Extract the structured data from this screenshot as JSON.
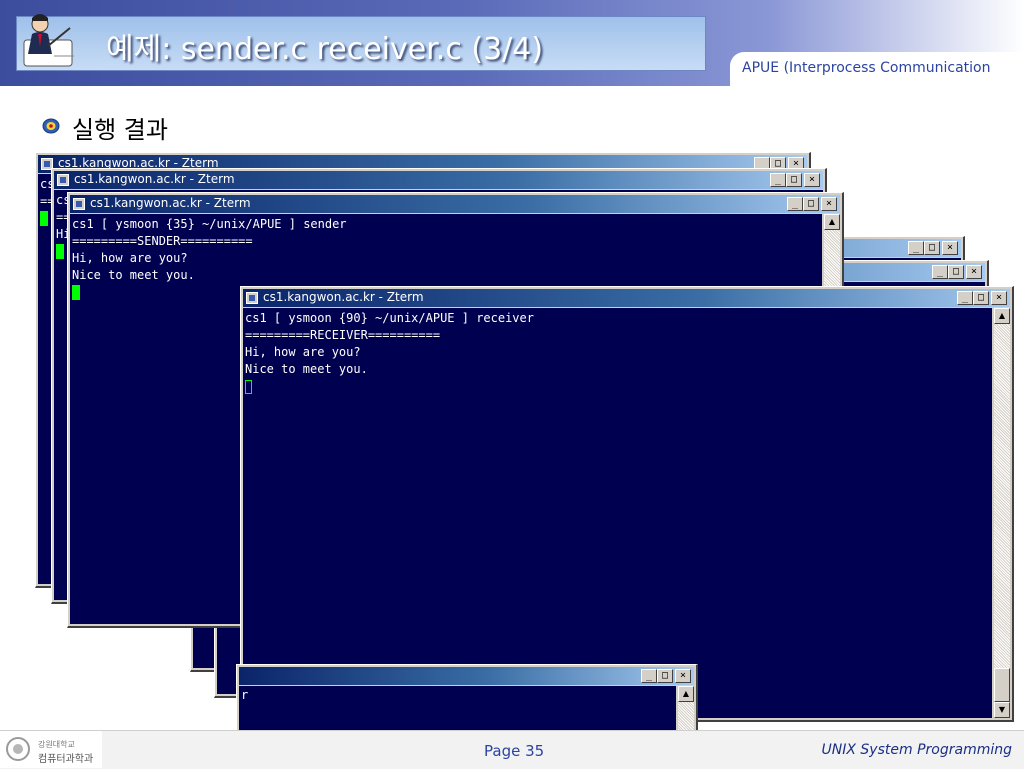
{
  "slide": {
    "title": "예제: sender.c receiver.c (3/4)",
    "subtitle": "APUE (Interprocess Communication",
    "bullet": "실행 결과",
    "logo_icon": "writing-man-icon",
    "bullet_icon_name": "university-emblem-icon"
  },
  "windows": {
    "back1": {
      "title": "cs1.kangwon.ac.kr - Zterm",
      "lines": [
        "cs",
        "==",
        "",
        "Hi",
        "",
        ""
      ]
    },
    "back2": {
      "title": "cs1.kangwon.ac.kr - Zterm",
      "lines": [
        "cs",
        "==",
        "Hi"
      ]
    },
    "sender": {
      "title": "cs1.kangwon.ac.kr - Zterm",
      "line1": "cs1 [ ysmoon {35} ~/unix/APUE ] sender",
      "line2": "=========SENDER==========",
      "line3": "Hi, how are you?",
      "line4": "Nice to meet you."
    },
    "receiver": {
      "title": "cs1.kangwon.ac.kr - Zterm",
      "line1": "cs1 [ ysmoon {90} ~/unix/APUE ] receiver",
      "line2": "=========RECEIVER==========",
      "line3": "Hi, how are you?",
      "line4": "Nice to meet you."
    },
    "bottom": {
      "line1": "r"
    }
  },
  "controls": {
    "minimize": "_",
    "maximize": "□",
    "close": "×",
    "scroll_up": "▲",
    "scroll_down": "▼"
  },
  "footer": {
    "university": "강원대학교",
    "department": "컴퓨터과학과",
    "page": "Page 35",
    "course": "UNIX System Programming"
  }
}
